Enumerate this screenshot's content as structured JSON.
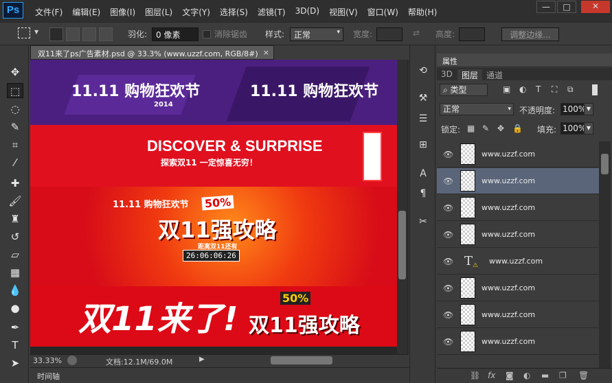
{
  "app": {
    "logo": "Ps"
  },
  "menu": [
    "文件(F)",
    "编辑(E)",
    "图像(I)",
    "图层(L)",
    "文字(Y)",
    "选择(S)",
    "滤镜(T)",
    "3D(D)",
    "视图(V)",
    "窗口(W)",
    "帮助(H)"
  ],
  "window": {
    "min": "—",
    "max": "□",
    "close": "✕"
  },
  "options": {
    "feather_label": "羽化:",
    "feather_value": "0 像素",
    "antialias_label": "消除锯齿",
    "style_label": "样式:",
    "style_value": "正常",
    "width_label": "宽度:",
    "height_label": "高度:",
    "refine_label": "调整边缘..."
  },
  "document": {
    "tab_title": "双11来了ps广告素材.psd @ 33.3% (www.uzzf.com, RGB/8#)",
    "close": "×",
    "zoom": "33.33%",
    "doc_info": "文档:12.1M/69.0M"
  },
  "canvas_content": {
    "banner1_text": "11.11 购物狂欢节",
    "banner1_year": "2014",
    "banner2_main": "DISCOVER & SURPRISE",
    "banner2_sub": "探索双11 一定惊喜无穷！",
    "banner3_badge": "50%",
    "banner3_title": "双11强攻略",
    "banner3_countdown_label": "距离双11还有",
    "banner3_countdown": "26:06:06:26",
    "banner4_main": "双11来了!",
    "banner4_title": "双11强攻略",
    "banner4_badge": "50%"
  },
  "timeline": {
    "label": "时间轴"
  },
  "panel": {
    "properties_tab": "属性",
    "tabs": [
      "3D",
      "图层",
      "通道"
    ],
    "filter_label": "类型",
    "blend_mode": "正常",
    "opacity_label": "不透明度:",
    "opacity_value": "100%",
    "lock_label": "锁定:",
    "fill_label": "填充:",
    "fill_value": "100%",
    "layers": [
      {
        "name": "www.uzzf.com"
      },
      {
        "name": "www.uzzf.com"
      },
      {
        "name": "www.uzzf.com"
      },
      {
        "name": "www.uzzf.com"
      },
      {
        "name": "www.uzzf.com"
      },
      {
        "name": "www.uzzf.com"
      },
      {
        "name": "www.uzzf.com"
      },
      {
        "name": "www.uzzf.com"
      }
    ]
  },
  "colors": {
    "accent": "#31a8ff",
    "selected_layer": "#5a6579",
    "canvas_red": "#d90d1c",
    "banner_purple": "#4b1f80"
  }
}
